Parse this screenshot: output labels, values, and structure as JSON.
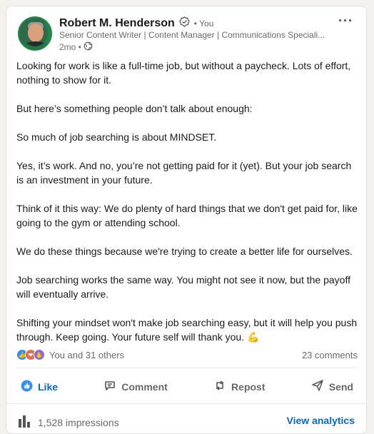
{
  "post": {
    "author": {
      "name": "Robert M. Henderson",
      "you_label": "• You",
      "headline": "Senior Content Writer | Content Manager | Communications Speciali...",
      "time": "2mo •",
      "avatar_icon": "profile-photo-opentowork"
    },
    "more_label": "···",
    "paragraphs": [
      "Looking for work is like a full-time job, but without a paycheck. Lots of effort, nothing to show for it.",
      "But here’s something people don’t talk about enough:",
      "So much of job searching is about MINDSET.",
      "Yes, it’s work. And no, you’re not getting paid for it (yet). But your job search is an investment in your future.",
      "Think of it this way: We do plenty of hard things that we don't get paid for, like going to the gym or attending school.",
      "We do these things because we're trying to create a better life for ourselves.",
      "Job searching works the same way. You might not see it now, but the payoff will eventually arrive.",
      "Shifting your mindset won't make job searching easy, but it will help you push through. Keep going. Your future self will thank you. 💪"
    ],
    "social": {
      "reactions_text": "You and 31 others",
      "comments_text": "23 comments"
    },
    "actions": {
      "like": "Like",
      "comment": "Comment",
      "repost": "Repost",
      "send": "Send"
    },
    "footer": {
      "impressions": "1,528 impressions",
      "analytics": "View analytics"
    },
    "colors": {
      "accent": "#0a66c2",
      "muted": "#666666",
      "opentowork": "#1e8a4a"
    }
  }
}
